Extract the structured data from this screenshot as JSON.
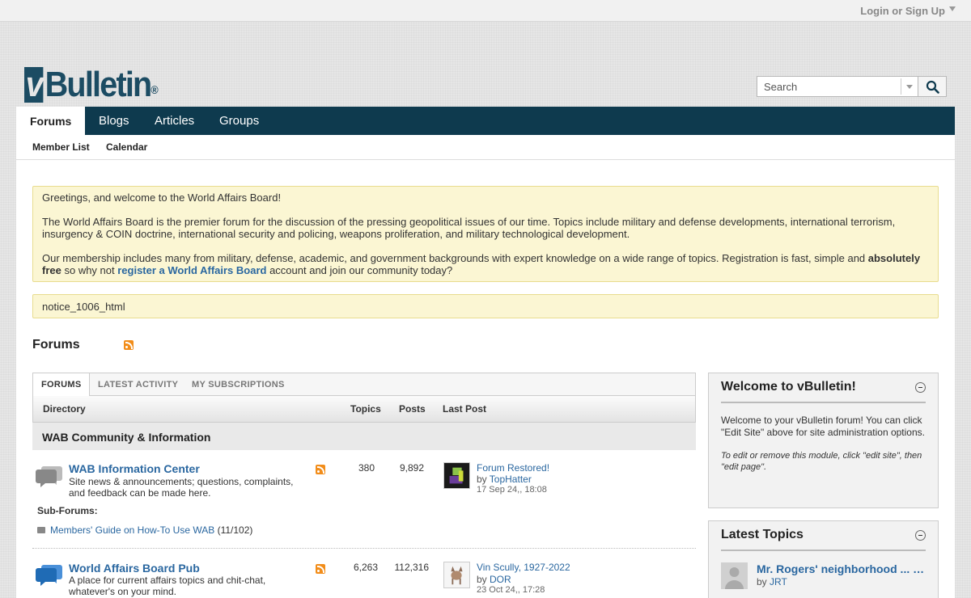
{
  "topbar": {
    "login_label": "Login or Sign Up"
  },
  "header": {
    "logo_text": "Bulletin",
    "logo_mark": "v",
    "logo_reg": "®",
    "search_placeholder": "Search"
  },
  "nav": {
    "tabs": [
      {
        "label": "Forums",
        "active": true
      },
      {
        "label": "Blogs"
      },
      {
        "label": "Articles"
      },
      {
        "label": "Groups"
      }
    ],
    "subnav": [
      "Member List",
      "Calendar"
    ]
  },
  "notice": {
    "greeting": "Greetings, and welcome to the World Affairs Board!",
    "para1": "The World Affairs Board is the premier forum for the discussion of the pressing geopolitical issues of our time. Topics include military and defense developments, international terrorism, insurgency & COIN doctrine, international security and policing, weapons proliferation, and military technological development.",
    "para2_start": "Our membership includes many from military, defense, academic, and government backgrounds with expert knowledge on a wide range of topics. Registration is fast, simple and ",
    "para2_bold": "absolutely free",
    "para2_mid": " so why not ",
    "para2_link": "register a World Affairs Board",
    "para2_end": " account and join our community today?",
    "notice2": "notice_1006_html"
  },
  "forums": {
    "title": "Forums",
    "tabs": [
      "FORUMS",
      "LATEST ACTIVITY",
      "MY SUBSCRIPTIONS"
    ],
    "headers": {
      "directory": "Directory",
      "topics": "Topics",
      "posts": "Posts",
      "last_post": "Last Post"
    },
    "category": "WAB Community & Information",
    "rows": [
      {
        "name": "WAB Information Center",
        "desc": "Site news & announcements; questions, complaints, and feedback can be made here.",
        "topics": "380",
        "posts": "9,892",
        "last_title": "Forum Restored!",
        "last_by_prefix": "by ",
        "last_by": "TopHatter",
        "last_date": "17 Sep 24,, 18:08",
        "subforums_label": "Sub-Forums:",
        "subforum_link": "Members' Guide on How-To Use WAB",
        "subforum_count": "(11/102)"
      },
      {
        "name": "World Affairs Board Pub",
        "desc": "A place for current affairs topics and chit-chat, whatever's on your mind.",
        "topics": "6,263",
        "posts": "112,316",
        "last_title": "Vin Scully, 1927-2022",
        "last_by_prefix": "by ",
        "last_by": "DOR",
        "last_date": "23 Oct 24,, 17:28"
      }
    ]
  },
  "sidebar": {
    "welcome": {
      "title": "Welcome to vBulletin!",
      "text": "Welcome to your vBulletin forum! You can click \"Edit Site\" above for site administration options.",
      "note": "To edit or remove this module, click \"edit site\", then \"edit page\"."
    },
    "latest": {
      "title": "Latest Topics",
      "items": [
        {
          "title": "Mr. Rogers' neighborhood ... (w...",
          "by_prefix": "by ",
          "by": "JRT"
        }
      ]
    }
  },
  "colors": {
    "navbar": "#0e3a4e",
    "link": "#2a67a0",
    "notice_bg": "#fbf6d3"
  }
}
